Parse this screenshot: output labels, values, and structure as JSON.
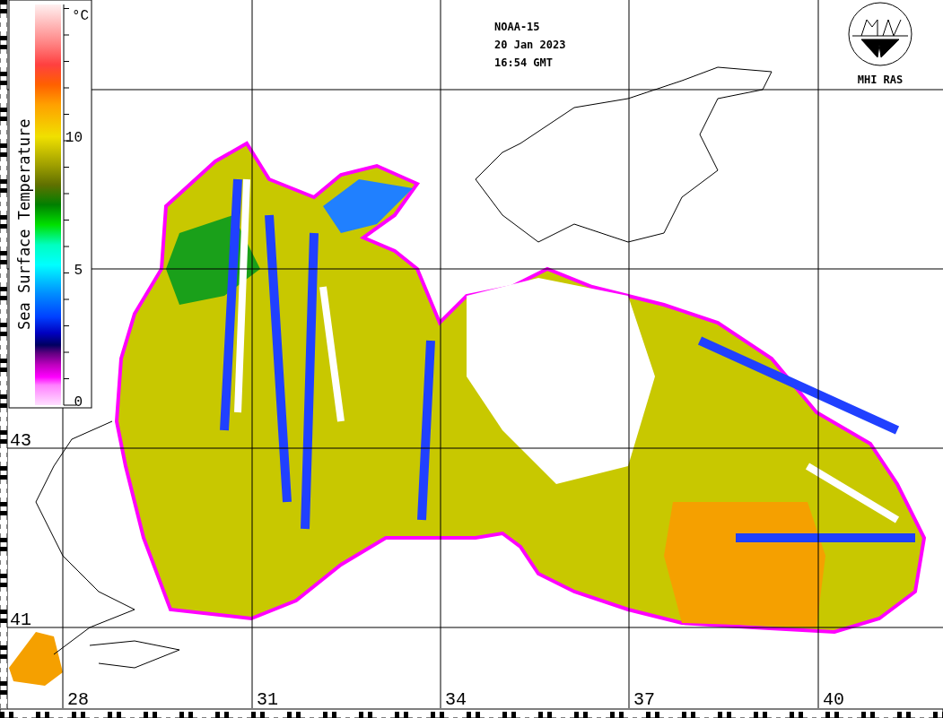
{
  "header": {
    "satellite": "NOAA-15",
    "date": "20 Jan 2023",
    "time": "16:54 GMT"
  },
  "logo": {
    "text": "MHI RAS"
  },
  "colorbar": {
    "title": "Sea Surface Temperature",
    "unit": "°C",
    "ticks": [
      "10",
      "5",
      "0"
    ]
  },
  "longitude_labels": [
    "28",
    "31",
    "34",
    "37",
    "40"
  ],
  "latitude_labels": [
    "43",
    "41"
  ]
}
